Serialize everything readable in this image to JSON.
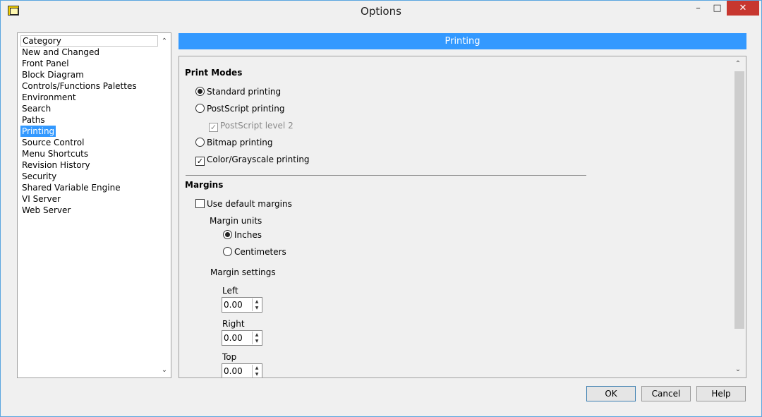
{
  "window": {
    "title": "Options"
  },
  "category": {
    "header": "Category",
    "items": [
      "New and Changed",
      "Front Panel",
      "Block Diagram",
      "Controls/Functions Palettes",
      "Environment",
      "Search",
      "Paths",
      "Printing",
      "Source Control",
      "Menu Shortcuts",
      "Revision History",
      "Security",
      "Shared Variable Engine",
      "VI Server",
      "Web Server"
    ],
    "selected": "Printing"
  },
  "panel": {
    "title": "Printing",
    "print_modes": {
      "label": "Print Modes",
      "standard": "Standard printing",
      "postscript": "PostScript printing",
      "postscript_level2": "PostScript level 2",
      "bitmap": "Bitmap printing",
      "color": "Color/Grayscale printing"
    },
    "margins": {
      "label": "Margins",
      "use_default": "Use default margins",
      "units_label": "Margin units",
      "inches": "Inches",
      "centimeters": "Centimeters",
      "settings_label": "Margin settings",
      "left_label": "Left",
      "left_value": "0.00",
      "right_label": "Right",
      "right_value": "0.00",
      "top_label": "Top",
      "top_value": "0.00"
    }
  },
  "buttons": {
    "ok": "OK",
    "cancel": "Cancel",
    "help": "Help"
  }
}
